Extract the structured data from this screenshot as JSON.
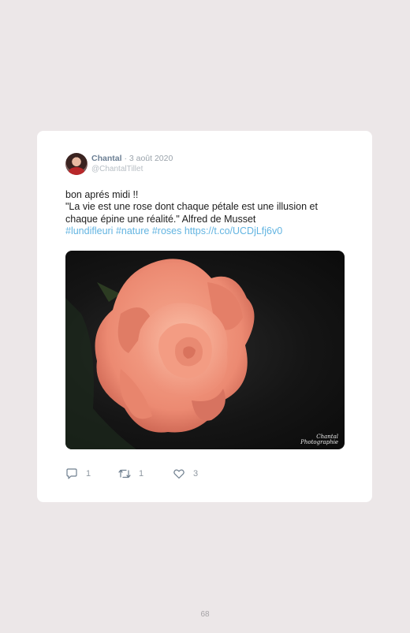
{
  "tweet": {
    "author_name": "Chantal",
    "date": "· 3 août 2020",
    "handle": "@ChantalTillet",
    "text_lines": [
      "bon aprés midi !!",
      "\"La vie est une rose dont chaque pétale est une illusion et",
      "chaque épine une réalité.\" Alfred de Musset"
    ],
    "hashtags": [
      "#lundifleuri",
      "#nature",
      "#roses"
    ],
    "link": "https://t.co/UCDjLfj6v0",
    "photo_signature": [
      "Chantal",
      "Photographie"
    ],
    "actions": {
      "replies": "1",
      "retweets": "1",
      "likes": "3"
    }
  },
  "colors": {
    "background": "#ece7e8",
    "link": "#62b4e1",
    "name": "#6b7f94"
  },
  "page": {
    "number": "68"
  }
}
